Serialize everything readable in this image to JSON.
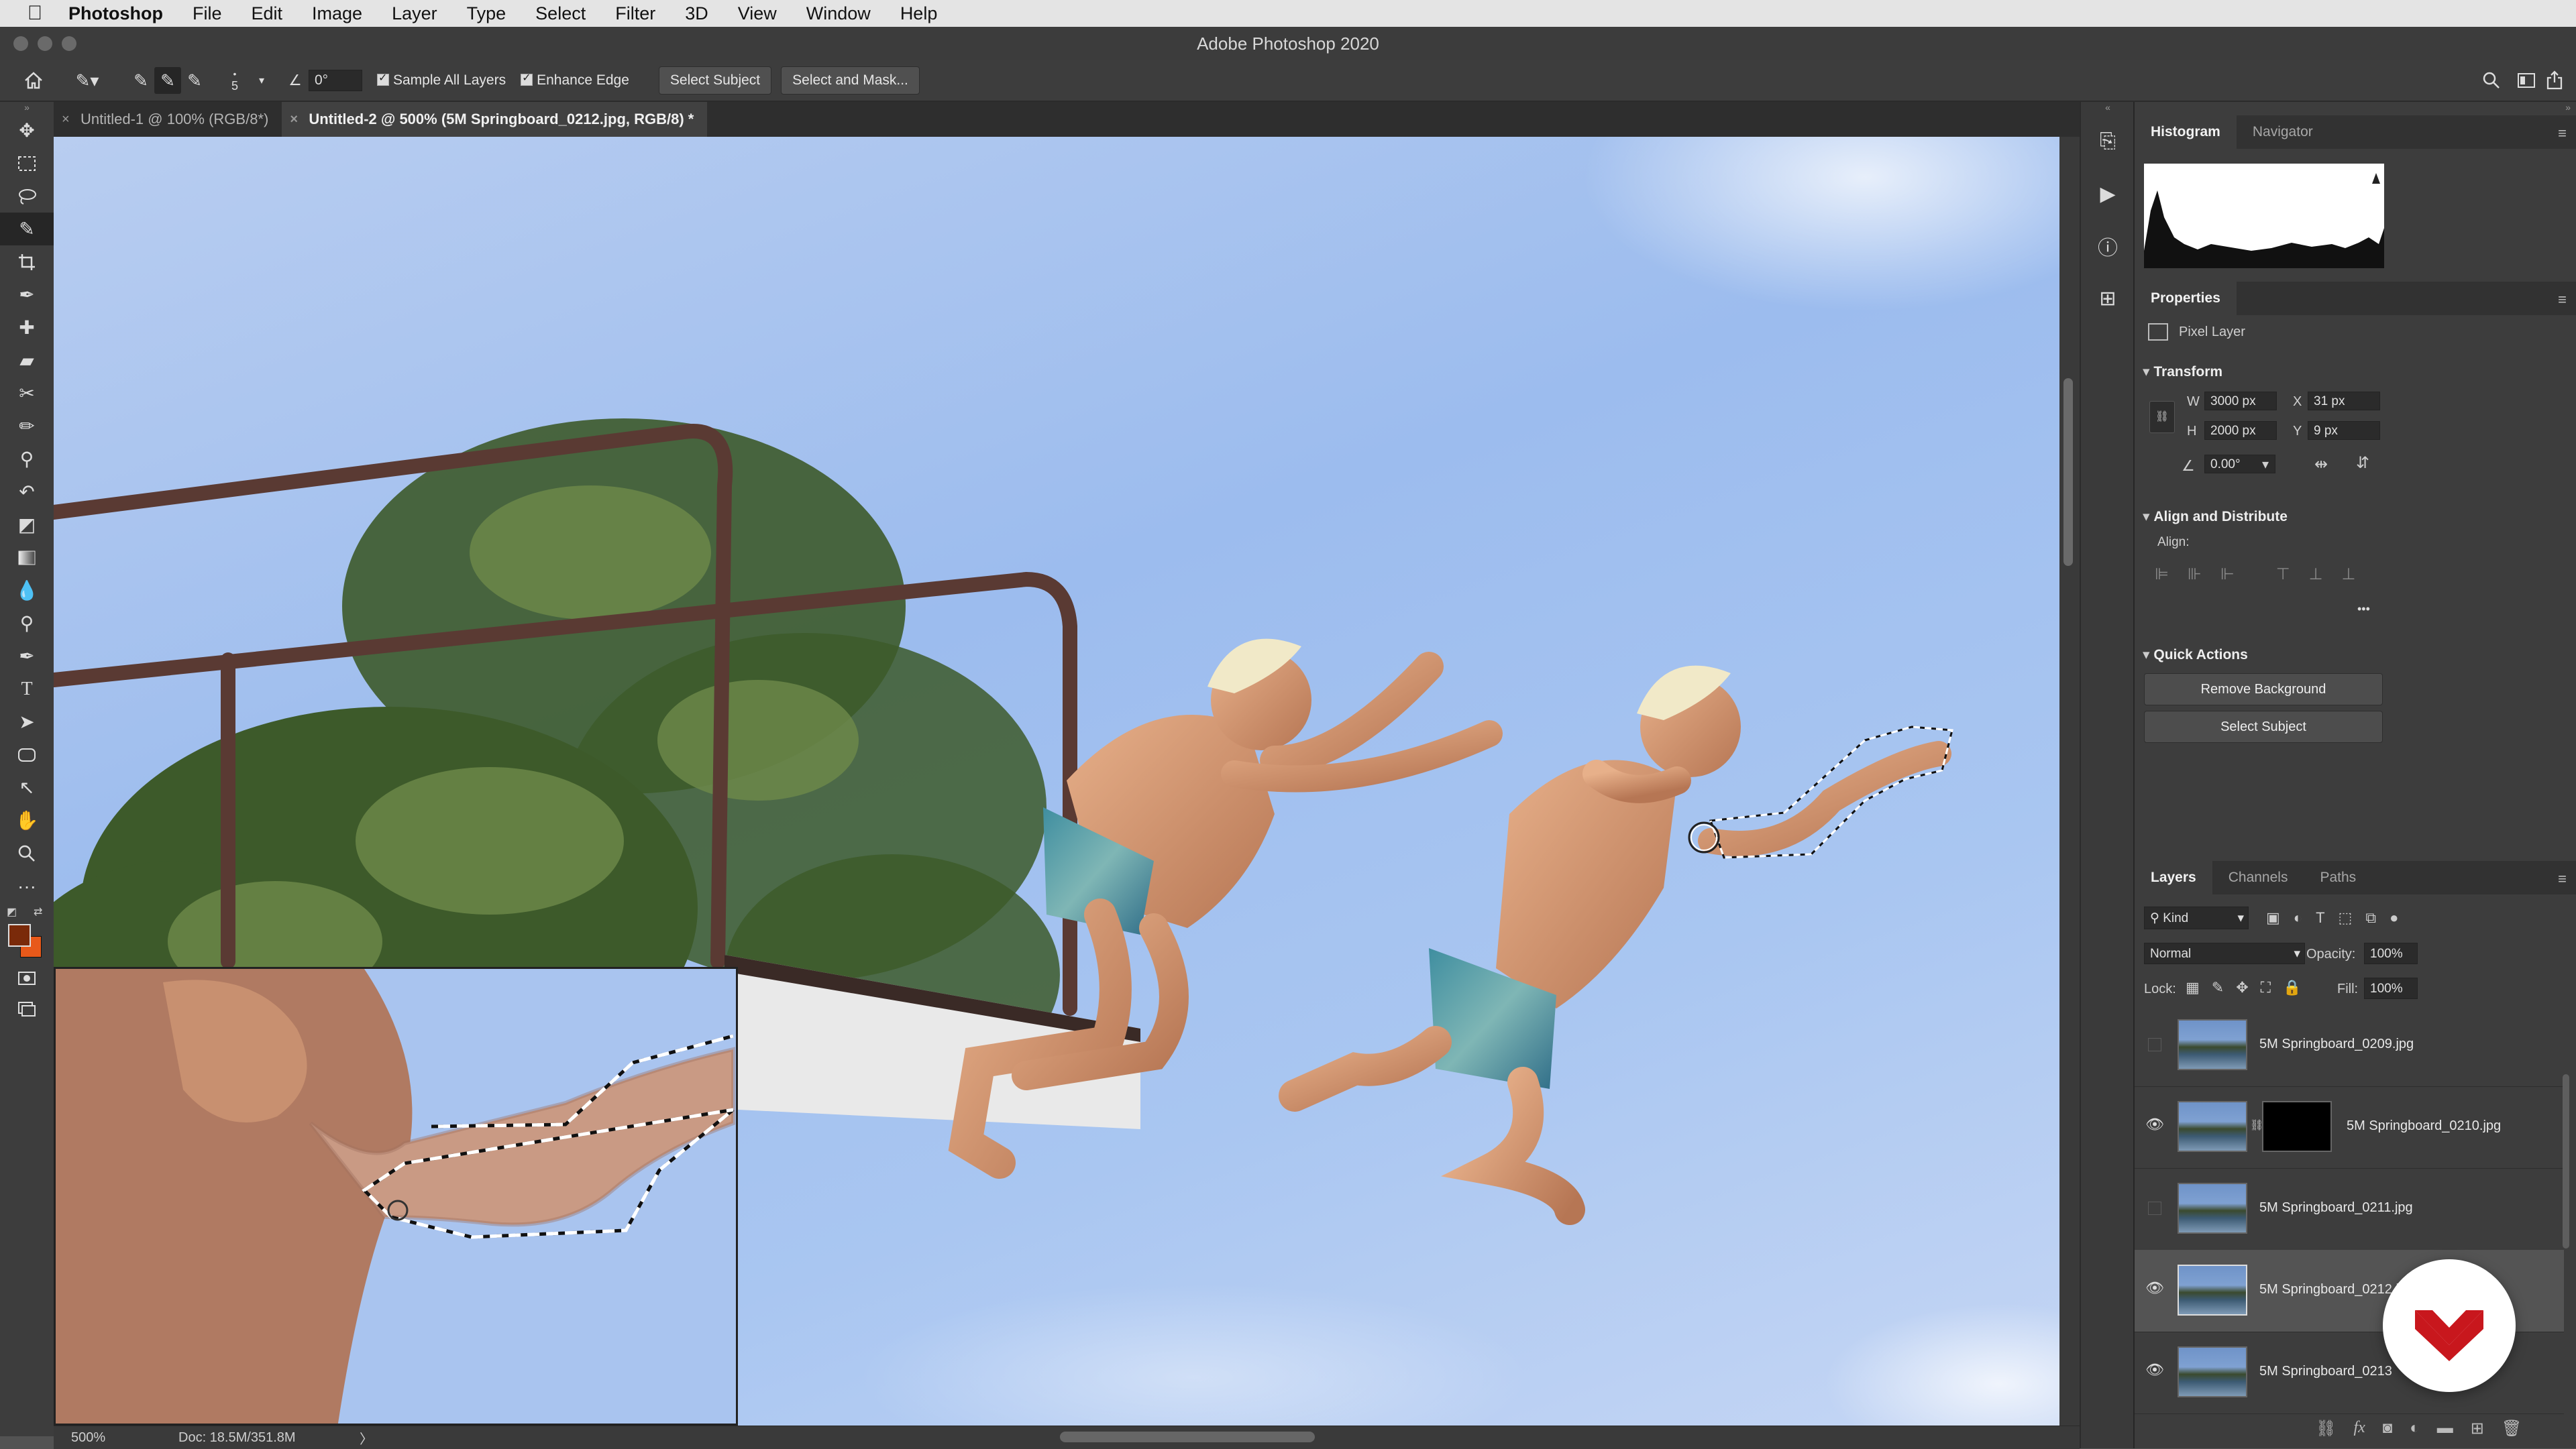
{
  "menubar": {
    "apple": "",
    "items": [
      "Photoshop",
      "File",
      "Edit",
      "Image",
      "Layer",
      "Type",
      "Select",
      "Filter",
      "3D",
      "View",
      "Window",
      "Help"
    ]
  },
  "window": {
    "title": "Adobe Photoshop 2020"
  },
  "options_bar": {
    "brush_size": "5",
    "angle": "0°",
    "sample_all_layers": "Sample All Layers",
    "enhance_edge": "Enhance Edge",
    "select_subject": "Select Subject",
    "select_and_mask": "Select and Mask..."
  },
  "tabs": [
    {
      "label": "Untitled-1 @ 100% (RGB/8*)",
      "active": false
    },
    {
      "label": "Untitled-2 @ 500% (5M Springboard_0212.jpg, RGB/8) *",
      "active": true
    }
  ],
  "status": {
    "zoom": "500%",
    "doc": "Doc: 18.5M/351.8M",
    "arrow": "〉"
  },
  "histogram_panel": {
    "tabs": [
      "Histogram",
      "Navigator"
    ]
  },
  "properties_panel": {
    "title": "Properties",
    "layer_kind": "Pixel Layer",
    "transform_title": "Transform",
    "w_label": "W",
    "w": "3000 px",
    "x_label": "X",
    "x": "31 px",
    "h_label": "H",
    "h": "2000 px",
    "y_label": "Y",
    "y": "9 px",
    "angle": "0.00°",
    "align_title": "Align and Distribute",
    "align_label": "Align:",
    "more": "•••",
    "quick_actions_title": "Quick Actions",
    "remove_background": "Remove Background",
    "select_subject": "Select Subject"
  },
  "layers_panel": {
    "tabs": [
      "Layers",
      "Channels",
      "Paths"
    ],
    "kind": "Kind",
    "blend_mode": "Normal",
    "opacity_label": "Opacity:",
    "opacity": "100%",
    "lock_label": "Lock:",
    "fill_label": "Fill:",
    "fill": "100%",
    "layers": [
      {
        "name": "5M Springboard_0209.jpg",
        "visible": false,
        "mask": false,
        "selected": false
      },
      {
        "name": "5M Springboard_0210.jpg",
        "visible": true,
        "mask": true,
        "selected": false
      },
      {
        "name": "5M Springboard_0211.jpg",
        "visible": false,
        "mask": false,
        "selected": false
      },
      {
        "name": "5M Springboard_0212.jpg",
        "visible": true,
        "mask": false,
        "selected": true
      },
      {
        "name": "5M Springboard_0213",
        "visible": true,
        "mask": false,
        "selected": false
      }
    ]
  },
  "colors": {
    "foreground": "#7a2a0a",
    "background": "#e8591a",
    "brand_red": "#c8171d"
  },
  "icons": {
    "tools": [
      "move-icon",
      "marquee-icon",
      "lasso-icon",
      "quick-selection-icon",
      "crop-icon",
      "eyedropper-icon",
      "healing-icon",
      "brush-ruler-icon",
      "patch-icon",
      "brush-icon",
      "clone-stamp-icon",
      "history-brush-icon",
      "eraser-icon",
      "gradient-icon",
      "blur-icon",
      "dodge-icon",
      "pen-icon",
      "type-icon",
      "path-selection-icon",
      "shape-icon",
      "direct-selection-icon",
      "hand-icon",
      "zoom-icon",
      "more-tools-icon"
    ]
  }
}
